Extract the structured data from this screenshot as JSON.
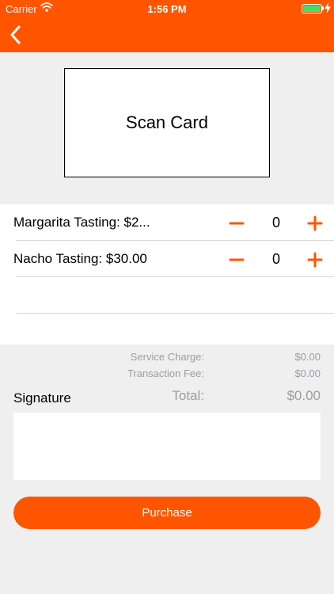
{
  "status": {
    "carrier": "Carrier",
    "time": "1:56 PM"
  },
  "header": {
    "back_icon": "chevron-left-icon"
  },
  "card": {
    "label": "Scan Card"
  },
  "items": [
    {
      "label": "Margarita Tasting: $2...",
      "quantity": "0"
    },
    {
      "label": "Nacho Tasting: $30.00",
      "quantity": "0"
    }
  ],
  "summary": {
    "service_charge_label": "Service Charge:",
    "service_charge_value": "$0.00",
    "transaction_fee_label": "Transaction Fee:",
    "transaction_fee_value": "$0.00",
    "total_label": "Total:",
    "total_value": "$0.00"
  },
  "signature": {
    "label": "Signature"
  },
  "purchase": {
    "label": "Purchase"
  },
  "colors": {
    "accent": "#ff5500",
    "background": "#efeff0",
    "muted_text": "#9d9da1"
  }
}
